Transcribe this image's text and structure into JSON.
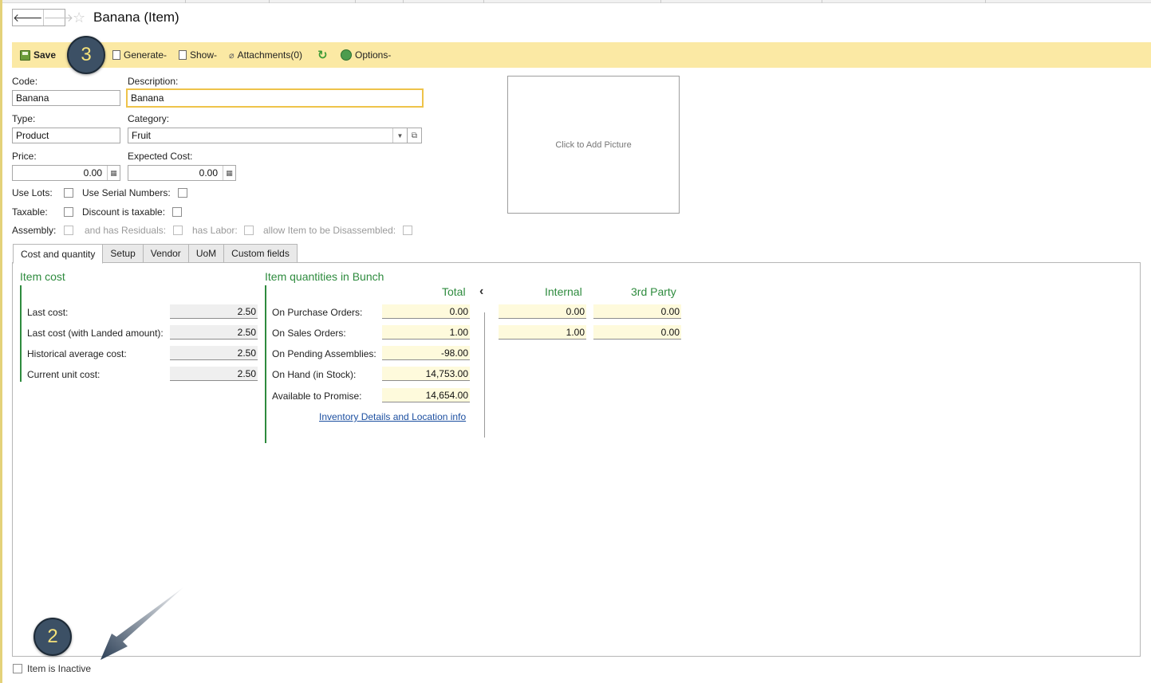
{
  "header": {
    "title": "Banana (Item)",
    "back_icon": "arrow-left-icon",
    "forward_icon": "arrow-right-icon",
    "favorite_icon": "star-icon"
  },
  "toolbar": {
    "save_label": "Save",
    "generate_label": "Generate",
    "show_label": "Show",
    "attachments_label": "Attachments(0)",
    "options_label": "Options",
    "dropdown_suffix": "-"
  },
  "callouts": {
    "badge_top": "3",
    "badge_bottom": "2"
  },
  "form": {
    "code_label": "Code:",
    "code_value": "Banana",
    "description_label": "Description:",
    "description_value": "Banana",
    "type_label": "Type:",
    "type_value": "Product",
    "category_label": "Category:",
    "category_value": "Fruit",
    "price_label": "Price:",
    "price_value": "0.00",
    "expected_cost_label": "Expected Cost:",
    "expected_cost_value": "0.00",
    "use_lots_label": "Use Lots:",
    "use_serial_label": "Use Serial Numbers:",
    "taxable_label": "Taxable:",
    "discount_taxable_label": "Discount is taxable:",
    "assembly_label": "Assembly:",
    "has_residuals_label": "and has Residuals:",
    "has_labor_label": "has Labor:",
    "disassemble_label": "allow Item to be Disassembled:",
    "picture_text": "Click to Add Picture"
  },
  "tabs": [
    {
      "label": "Cost and quantity",
      "active": true
    },
    {
      "label": "Setup"
    },
    {
      "label": "Vendor"
    },
    {
      "label": "UoM"
    },
    {
      "label": "Custom fields"
    }
  ],
  "item_cost": {
    "title": "Item cost",
    "rows": [
      {
        "label": "Last cost:",
        "value": "2.50"
      },
      {
        "label": "Last cost (with Landed amount):",
        "value": "2.50"
      },
      {
        "label": "Historical average cost:",
        "value": "2.50"
      },
      {
        "label": "Current unit cost:",
        "value": "2.50"
      }
    ]
  },
  "item_quantities": {
    "title": "Item quantities in Bunch",
    "col_total": "Total",
    "col_internal": "Internal",
    "col_third_party": "3rd Party",
    "rows": [
      {
        "label": "On Purchase Orders:",
        "total": "0.00",
        "internal": "0.00",
        "third_party": "0.00"
      },
      {
        "label": "On Sales Orders:",
        "total": "1.00",
        "internal": "1.00",
        "third_party": "0.00"
      },
      {
        "label": "On Pending Assemblies:",
        "total": "-98.00"
      },
      {
        "label": "On Hand (in Stock):",
        "total": "14,753.00"
      },
      {
        "label": "Available to Promise:",
        "total": "14,654.00"
      }
    ],
    "link_text": "Inventory Details and Location info"
  },
  "footer": {
    "inactive_label": "Item is Inactive"
  }
}
